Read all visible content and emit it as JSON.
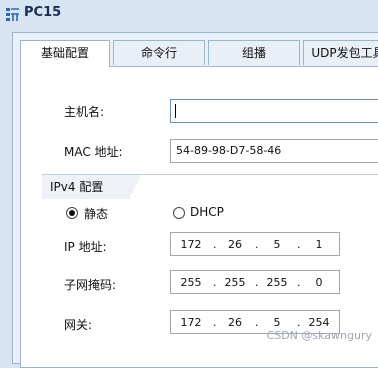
{
  "window": {
    "title": "PC15",
    "icon": "pc-icon"
  },
  "tabs": [
    {
      "label": "基础配置",
      "active": true
    },
    {
      "label": "命令行",
      "active": false
    },
    {
      "label": "组播",
      "active": false
    },
    {
      "label": "UDP发包工具",
      "active": false
    }
  ],
  "basic": {
    "hostname_label": "主机名:",
    "hostname_value": "",
    "mac_label": "MAC 地址:",
    "mac_value": "54-89-98-D7-58-46"
  },
  "ipv4": {
    "section_label": "IPv4 配置",
    "static_label": "静态",
    "dhcp_label": "DHCP",
    "mode": "静态",
    "ip_label": "IP 地址:",
    "ip": [
      "172",
      "26",
      "5",
      "1"
    ],
    "mask_label": "子网掩码:",
    "mask": [
      "255",
      "255",
      "255",
      "0"
    ],
    "gateway_label": "网关:",
    "gateway": [
      "172",
      "26",
      "5",
      "254"
    ]
  },
  "watermark": "CSDN @skawngury",
  "colors": {
    "window_bg": "#d7e4f2",
    "panel_bg": "#ffffff",
    "title": "#1a2f55"
  }
}
